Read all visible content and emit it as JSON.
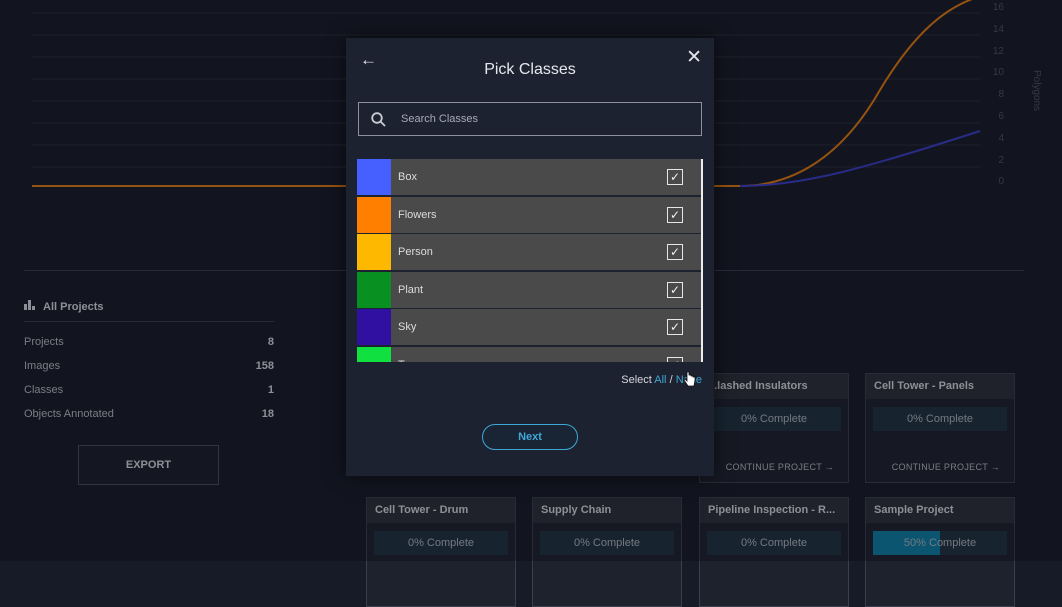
{
  "chart": {
    "ylabel": "Polygons",
    "y_ticks": [
      "16",
      "14",
      "12",
      "10",
      "8",
      "6",
      "4",
      "2",
      "0"
    ]
  },
  "stats": {
    "title": "All Projects",
    "rows": [
      {
        "label": "Projects",
        "value": "8"
      },
      {
        "label": "Images",
        "value": "158"
      },
      {
        "label": "Classes",
        "value": "1"
      },
      {
        "label": "Objects Annotated",
        "value": "18"
      }
    ],
    "export_label": "EXPORT"
  },
  "projects": [
    {
      "title": "...lashed Insulators",
      "progress": 0,
      "status": "0% Complete",
      "action": "CONTINUE PROJECT"
    },
    {
      "title": "Cell Tower - Panels",
      "progress": 0,
      "status": "0% Complete",
      "action": "CONTINUE PROJECT"
    },
    {
      "title": "Cell Tower - Drum",
      "progress": 0,
      "status": "0% Complete"
    },
    {
      "title": "Supply Chain",
      "progress": 0,
      "status": "0% Complete"
    },
    {
      "title": "Pipeline Inspection - R...",
      "progress": 0,
      "status": "0% Complete"
    },
    {
      "title": "Sample Project",
      "progress": 0.5,
      "status": "50% Complete"
    }
  ],
  "modal": {
    "title": "Pick Classes",
    "search_placeholder": "Search Classes",
    "classes": [
      {
        "name": "Box",
        "color": "#4660ff",
        "checked": true
      },
      {
        "name": "Flowers",
        "color": "#ff8000",
        "checked": true
      },
      {
        "name": "Person",
        "color": "#ffb800",
        "checked": true
      },
      {
        "name": "Plant",
        "color": "#089020",
        "checked": true
      },
      {
        "name": "Sky",
        "color": "#3010a0",
        "checked": true
      },
      {
        "name": "T...",
        "color": "#10e040",
        "checked": true
      }
    ],
    "select_prefix": "Select",
    "select_all": "All",
    "select_separator": "/",
    "select_none": "None",
    "next_label": "Next"
  },
  "colors": {
    "line_orange": "#e07a10",
    "line_blue": "#3a3fc6",
    "accent": "#3fa7d6"
  }
}
